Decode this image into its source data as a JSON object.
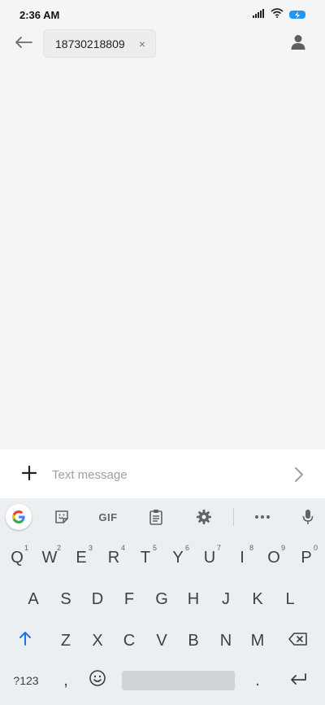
{
  "status_bar": {
    "time": "2:36 AM",
    "icons": [
      "signal-icon",
      "wifi-icon",
      "battery-charging-icon"
    ],
    "battery_color": "#2196f3"
  },
  "header": {
    "back_icon": "arrow-left-icon",
    "recipient": "18730218809",
    "chip_close": "×",
    "contact_icon": "person-icon"
  },
  "compose": {
    "placeholder": "Text message",
    "add_icon": "plus-icon",
    "send_icon": "chevron-right-icon"
  },
  "keyboard": {
    "toolbar": {
      "gif_label": "GIF",
      "items": [
        "google-icon",
        "sticker-icon",
        "gif-icon",
        "clipboard-icon",
        "gear-icon",
        "more-icon",
        "mic-icon"
      ]
    },
    "row1": [
      {
        "label": "Q",
        "hint": "1"
      },
      {
        "label": "W",
        "hint": "2"
      },
      {
        "label": "E",
        "hint": "3"
      },
      {
        "label": "R",
        "hint": "4"
      },
      {
        "label": "T",
        "hint": "5"
      },
      {
        "label": "Y",
        "hint": "6"
      },
      {
        "label": "U",
        "hint": "7"
      },
      {
        "label": "I",
        "hint": "8"
      },
      {
        "label": "O",
        "hint": "9"
      },
      {
        "label": "P",
        "hint": "0"
      }
    ],
    "row2": [
      "A",
      "S",
      "D",
      "F",
      "G",
      "H",
      "J",
      "K",
      "L"
    ],
    "row3": [
      "Z",
      "X",
      "C",
      "V",
      "B",
      "N",
      "M"
    ],
    "row4": {
      "symbols": "?123",
      "comma": ",",
      "period": "."
    },
    "accent_color": "#1a73e8"
  }
}
